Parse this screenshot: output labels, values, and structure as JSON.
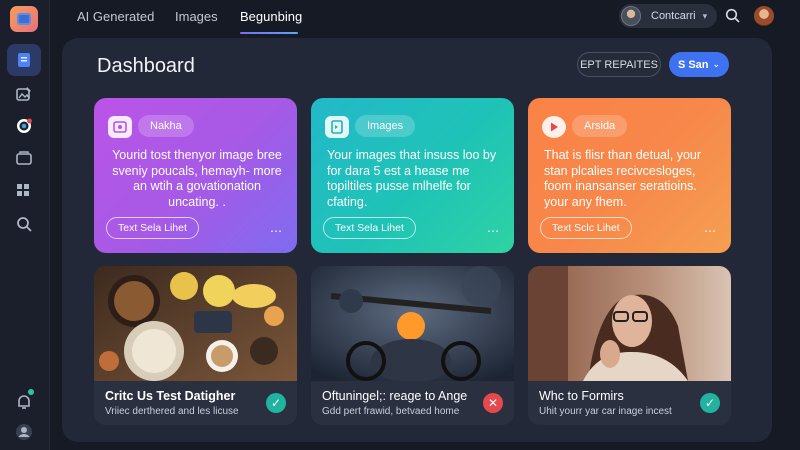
{
  "topbar": {
    "tabs": [
      {
        "label": "AI Generated"
      },
      {
        "label": "Images"
      },
      {
        "label": "Begunbing",
        "active": true
      }
    ],
    "user_name": "Contcarri",
    "colors": {
      "accent": "#3f72f0",
      "underline": "#7b6cf6"
    }
  },
  "sidebar": {
    "items": [
      {
        "icon": "document-icon",
        "active": true
      },
      {
        "icon": "image-edit-icon"
      },
      {
        "icon": "camera-icon"
      },
      {
        "icon": "folder-icon"
      },
      {
        "icon": "grid-icon"
      },
      {
        "icon": "search-icon"
      },
      {
        "icon": "notification-icon"
      },
      {
        "icon": "user-icon"
      }
    ]
  },
  "main": {
    "title": "Dashboard",
    "buttons": {
      "outline_label": "EPT REPAITES",
      "primary_label": "S San",
      "primary_chevron": "⌄"
    },
    "cards": [
      {
        "chip": "Nakha",
        "text": "Yourid tost thenyor image bree sveniy poucals, hemayh- more an wtih a govationation uncating. .",
        "button": "Text Sela Lihet",
        "more": "⋯",
        "color": "#b456e7"
      },
      {
        "chip": "Images",
        "text": "Your images that insuss loo by for dara 5 est a hease me topiltiles pusse mlhelfe for cfating.",
        "button": "Text Sela Lihet",
        "more": "⋯",
        "color": "#22bcc0"
      },
      {
        "chip": "Arsida",
        "text": "That is flisr than detual, your stan plcalies recivcesloges, foom inansanser seratioins. your any fhem.",
        "button": "Text Sclc Lihet",
        "more": "⋯",
        "color": "#f7874a"
      }
    ],
    "image_cards": [
      {
        "title": "Critc Us Test Datigher",
        "subtitle": "Vriiec derthered and les licuse",
        "status": "✓",
        "status_type": "ok"
      },
      {
        "title": "Oftuningel;: reage to Ange",
        "subtitle": "Gdd pert frawid, betvaed home",
        "status": "✕",
        "status_type": "no"
      },
      {
        "title": "Whc to Formirs",
        "subtitle": "Uhit yourr yar car inage incest",
        "status": "✓",
        "status_type": "ok"
      }
    ]
  }
}
